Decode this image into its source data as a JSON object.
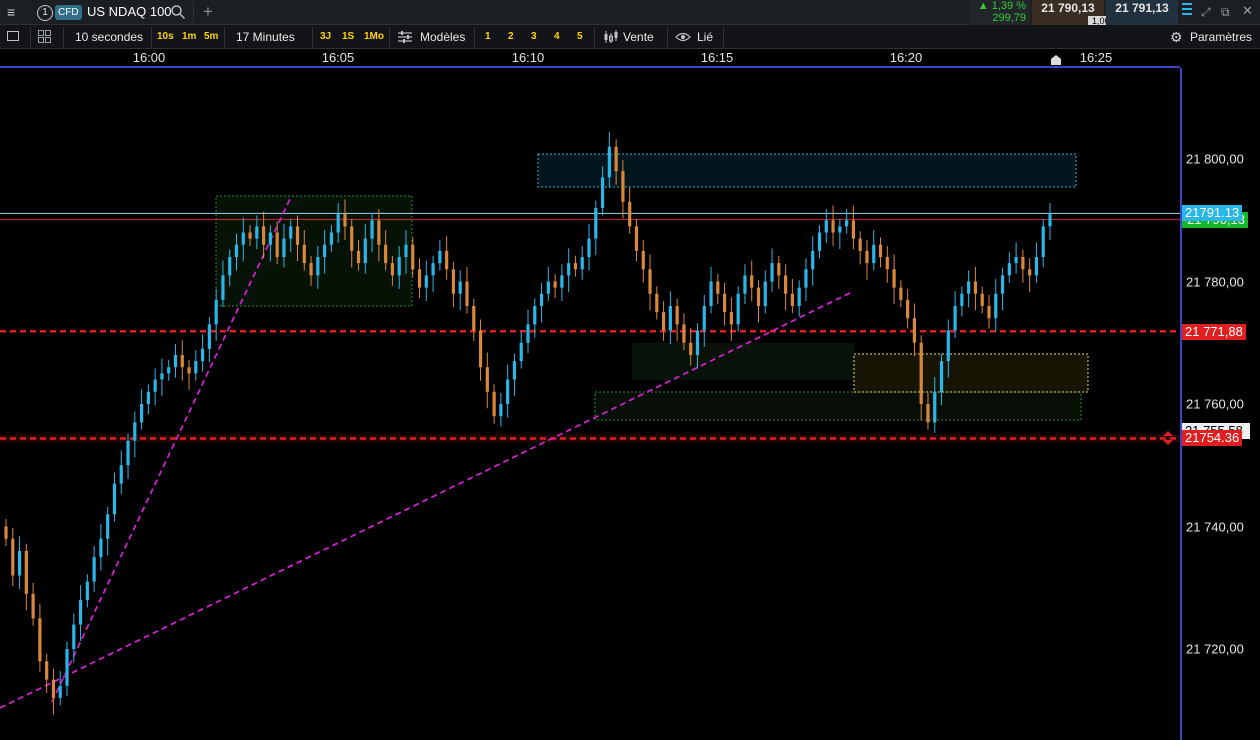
{
  "header": {
    "menu_icon": "hamburger-icon",
    "instrument_number": "1",
    "type_badge": "CFD",
    "instrument_name": "US NDAQ 100",
    "change_pct": "▲ 1,39 %",
    "change_pts": "299,79",
    "bid": "21 790,13",
    "ask": "21 791,13",
    "spread": "1,00"
  },
  "toolbar": {
    "interval": "10 secondes",
    "quick_intervals": [
      "10s",
      "1m",
      "5m"
    ],
    "duration": "17 Minutes",
    "quick_ranges": [
      "3J",
      "1S",
      "1Mo"
    ],
    "templates_label": "Modèles",
    "template_slots": [
      "1",
      "2",
      "3",
      "4",
      "5"
    ],
    "price_mode": "Vente",
    "link_label": "Lié",
    "settings_label": "Paramètres"
  },
  "chart_data": {
    "type": "candlestick",
    "x_ticks": [
      "16:00",
      "16:05",
      "16:10",
      "16:15",
      "16:20",
      "16:25"
    ],
    "y_ticks": [
      "21 800,00",
      "21 780,00",
      "21 760,00",
      "21 740,00",
      "21 720,00"
    ],
    "ylim": [
      21704,
      21826
    ],
    "colors": {
      "up": "#29b6e8",
      "down": "#d9883a",
      "red_line": "#e02020",
      "trend": "#d020d0"
    },
    "current_price_label": "21791.13",
    "current_price": 21791.13,
    "green_tag_label": "21 790,13",
    "level_1_label": "21 771,88",
    "level_1": 21771.88,
    "level_2_label": "21 755,58",
    "level_2": 21755.58,
    "level_3_label": "21754.36",
    "level_3": 21754.36
  }
}
